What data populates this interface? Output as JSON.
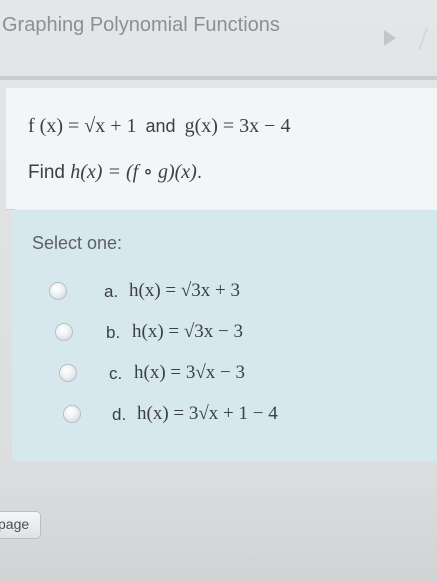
{
  "header": {
    "title": "Graphing Polynomial Functions"
  },
  "question": {
    "f_def": "f (x) = √x + 1",
    "and_word": "and",
    "g_def": "g(x) = 3x − 4",
    "find_word": "Find",
    "h_def": "h(x) = (f ∘ g)(x)",
    "end_punct": "."
  },
  "answers": {
    "select_label": "Select one:",
    "options": [
      {
        "letter": "a.",
        "expr": "h(x) = √3x + 3"
      },
      {
        "letter": "b.",
        "expr": "h(x) = √3x − 3"
      },
      {
        "letter": "c.",
        "expr": "h(x) = 3√x − 3"
      },
      {
        "letter": "d.",
        "expr": "h(x) = 3√x + 1 − 4"
      }
    ]
  },
  "footer": {
    "page_label": "page"
  }
}
